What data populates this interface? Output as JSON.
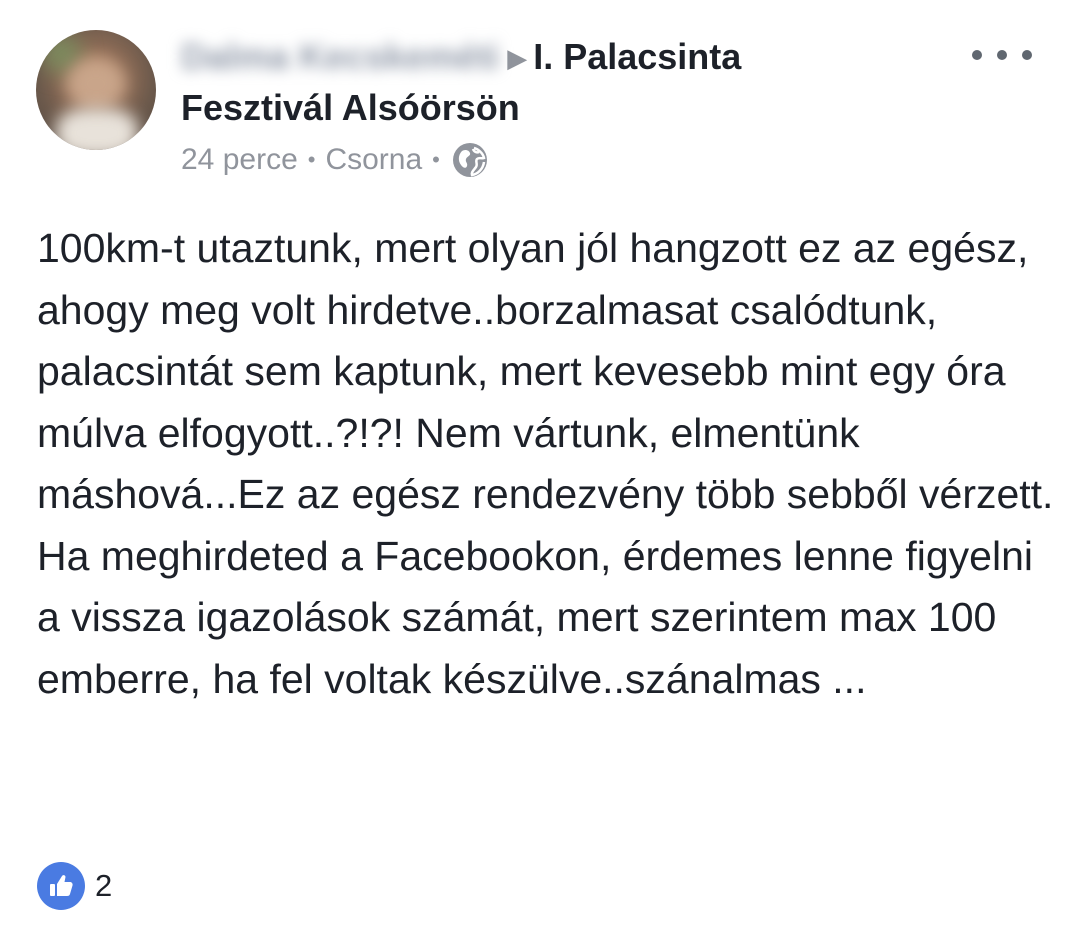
{
  "post": {
    "author_name": "Dalma Kecskeméti",
    "arrow": "▶",
    "target_page": "I. Palacsinta Fesztivál Alsóörsön",
    "target_line1": "I. Palacsinta",
    "target_line2": "Fesztivál Alsóörsön",
    "time": "24 perce",
    "location": "Csorna",
    "separator": "•",
    "privacy_icon": "globe-icon",
    "more_icon": "more-options-icon",
    "text": "100km-t utaztunk, mert olyan jól hangzott ez az egész, ahogy meg volt hirdetve..borzalmasat csalódtunk, palacsintát sem kaptunk, mert kevesebb mint egy óra múlva elfogyott..?!?! Nem vártunk, elmentünk máshová...Ez az egész rendezvény több sebből vérzett. Ha meghirdeted a Facebookon, érdemes lenne figyelni a vissza igazolások számát, mert szerintem max 100 emberre, ha fel voltak készülve..szánalmas ...",
    "reactions": {
      "icon": "like-icon",
      "count": "2"
    }
  },
  "colors": {
    "text": "#1d2129",
    "meta": "#90949c",
    "like_blue": "#4a7be2"
  }
}
